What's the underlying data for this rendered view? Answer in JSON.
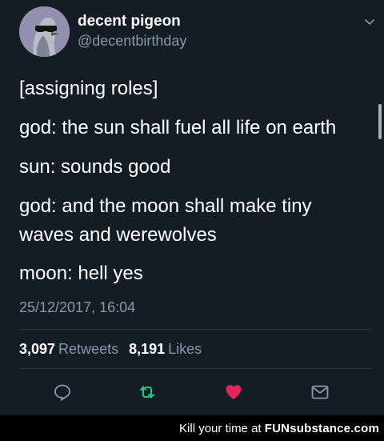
{
  "user": {
    "display_name": "decent pigeon",
    "handle": "@decentbirthday"
  },
  "tweet": {
    "lines": [
      "[assigning roles]",
      "god: the sun shall fuel all life on earth",
      "sun: sounds good",
      "god: and the moon shall make tiny",
      "waves and werewolves",
      "moon: hell yes"
    ],
    "timestamp": "25/12/2017, 16:04"
  },
  "stats": {
    "retweets_count": "3,097",
    "retweets_label": "Retweets",
    "likes_count": "8,191",
    "likes_label": "Likes"
  },
  "icons": {
    "avatar": "pigeon-with-sunglasses-avatar",
    "menu": "chevron-down-icon",
    "reply": "reply-bubble-icon",
    "retweet": "retweet-icon",
    "like": "heart-icon",
    "dm": "envelope-icon"
  },
  "colors": {
    "background": "#141d26",
    "secondary_text": "#8899a6",
    "retweet_green": "#19cf86",
    "like_red": "#e0245e"
  },
  "watermark": {
    "prefix": "Kill your time at",
    "brand_text": "FUNsubstance.com"
  }
}
